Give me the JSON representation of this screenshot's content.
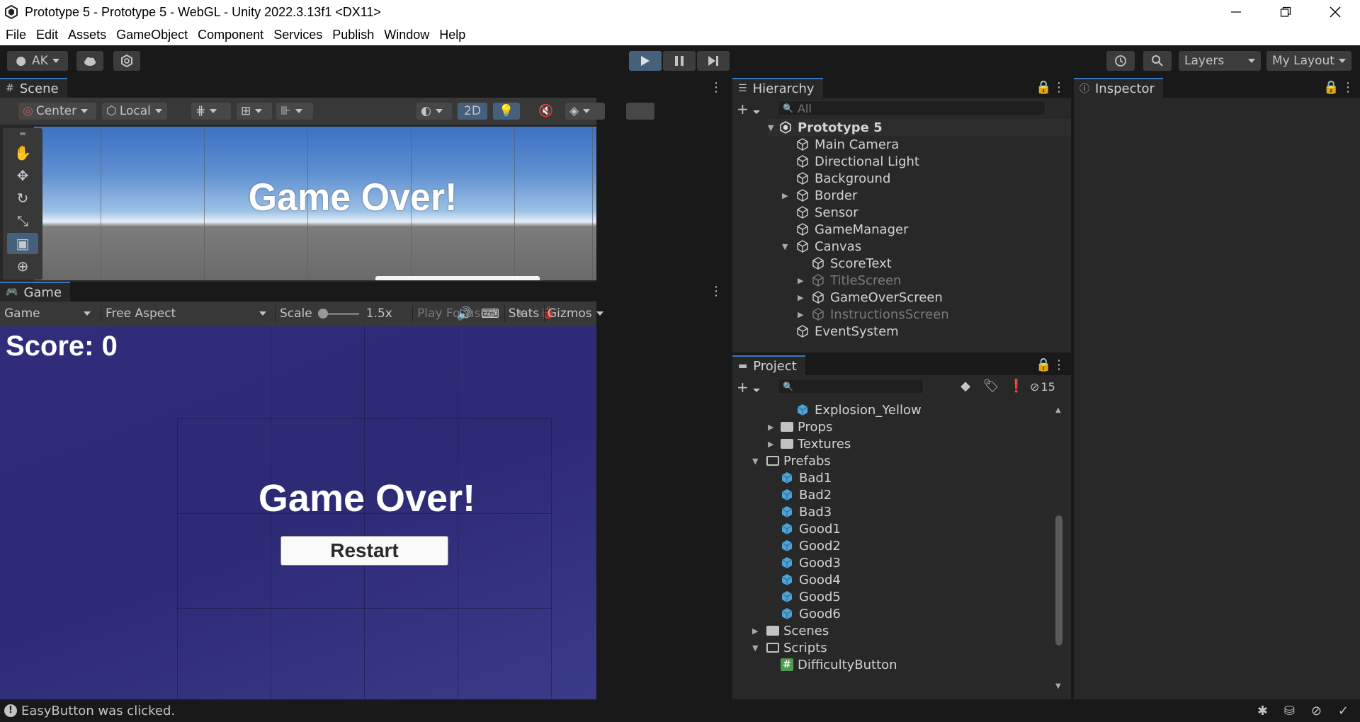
{
  "window": {
    "title": "Prototype 5 - Prototype 5 - WebGL - Unity 2022.3.13f1 <DX11>",
    "minimize_icon": "minimize-icon",
    "maximize_icon": "restore-icon",
    "close_icon": "close-icon"
  },
  "menu": [
    "File",
    "Edit",
    "Assets",
    "GameObject",
    "Component",
    "Services",
    "Publish",
    "Window",
    "Help"
  ],
  "toolbar": {
    "account": "AK",
    "layers": "Layers",
    "layout": "My Layout"
  },
  "scene": {
    "tab": "Scene",
    "pivot": "Center",
    "space": "Local",
    "mode_2d": "2D",
    "overlay_text": "Game Over!"
  },
  "game": {
    "tab": "Game",
    "display": "Game",
    "aspect": "Free Aspect",
    "scale_label": "Scale",
    "scale_value": "1.5x",
    "play_mode": "Play Focused",
    "stats": "Stats",
    "gizmos": "Gizmos",
    "score_text": "Score: 0",
    "game_over_text": "Game Over!",
    "restart_label": "Restart"
  },
  "hierarchy": {
    "tab": "Hierarchy",
    "search_placeholder": "All",
    "scene_root": "Prototype 5",
    "items": [
      {
        "label": "Main Camera",
        "dim": false
      },
      {
        "label": "Directional Light",
        "dim": false
      },
      {
        "label": "Background",
        "dim": false
      },
      {
        "label": "Border",
        "dim": false
      },
      {
        "label": "Sensor",
        "dim": false
      },
      {
        "label": "GameManager",
        "dim": false
      },
      {
        "label": "Canvas",
        "dim": false
      },
      {
        "label": "ScoreText",
        "dim": false
      },
      {
        "label": "TitleScreen",
        "dim": true
      },
      {
        "label": "GameOverScreen",
        "dim": false
      },
      {
        "label": "InstructionsScreen",
        "dim": true
      },
      {
        "label": "EventSystem",
        "dim": false
      }
    ]
  },
  "inspector": {
    "tab": "Inspector"
  },
  "project": {
    "tab": "Project",
    "hidden_count": "15",
    "items": [
      {
        "label": "Explosion_Yellow",
        "kind": "prefab"
      },
      {
        "label": "Props",
        "kind": "folder"
      },
      {
        "label": "Textures",
        "kind": "folder"
      },
      {
        "label": "Prefabs",
        "kind": "folder-open"
      },
      {
        "label": "Bad1",
        "kind": "prefab"
      },
      {
        "label": "Bad2",
        "kind": "prefab"
      },
      {
        "label": "Bad3",
        "kind": "prefab"
      },
      {
        "label": "Good1",
        "kind": "prefab"
      },
      {
        "label": "Good2",
        "kind": "prefab"
      },
      {
        "label": "Good3",
        "kind": "prefab"
      },
      {
        "label": "Good4",
        "kind": "prefab"
      },
      {
        "label": "Good5",
        "kind": "prefab"
      },
      {
        "label": "Good6",
        "kind": "prefab"
      },
      {
        "label": "Scenes",
        "kind": "folder"
      },
      {
        "label": "Scripts",
        "kind": "folder-open"
      },
      {
        "label": "DifficultyButton",
        "kind": "script"
      }
    ]
  },
  "status": {
    "message": "EasyButton was clicked."
  }
}
